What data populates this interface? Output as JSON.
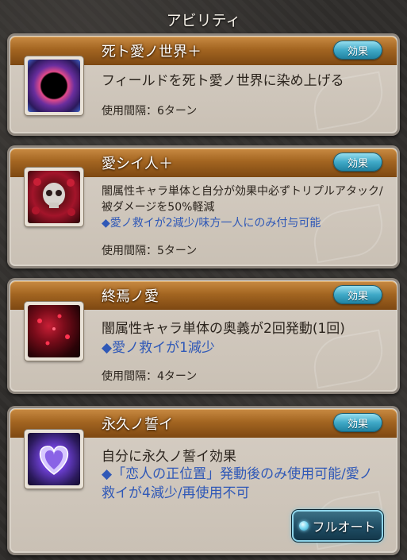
{
  "header": {
    "title": "アビリティ"
  },
  "abilities": [
    {
      "name": "死ト愛ノ世界＋",
      "effect_label": "効果",
      "description": "フィールドを死ト愛ノ世界に染め上げる",
      "note": "",
      "cooldown": "使用間隔：6ターン",
      "icon": "black-sun-icon"
    },
    {
      "name": "愛シイ人＋",
      "effect_label": "効果",
      "description": "闇属性キャラ単体と自分が効果中必ずトリプルアタック/被ダメージを50%軽減",
      "note": "◆愛ノ救イが2減少/味方一人にのみ付与可能",
      "cooldown": "使用間隔：5ターン",
      "icon": "skull-roses-icon"
    },
    {
      "name": "終焉ノ愛",
      "effect_label": "効果",
      "description": "闇属性キャラ単体の奥義が2回発動(1回)",
      "note": "◆愛ノ救イが1減少",
      "cooldown": "使用間隔：4ターン",
      "icon": "red-petals-icon"
    },
    {
      "name": "永久ノ誓イ",
      "effect_label": "効果",
      "description": "自分に永久ノ誓イ効果",
      "note": "◆「恋人の正位置」発動後のみ使用可能/愛ノ救イが4減少/再使用不可",
      "cooldown": "",
      "icon": "heart-crystal-icon"
    }
  ],
  "full_auto_label": "フルオート",
  "colors": {
    "bar_orange": "#a36521",
    "note_blue": "#2f58b7",
    "effect_button": "#3fa9c7"
  }
}
